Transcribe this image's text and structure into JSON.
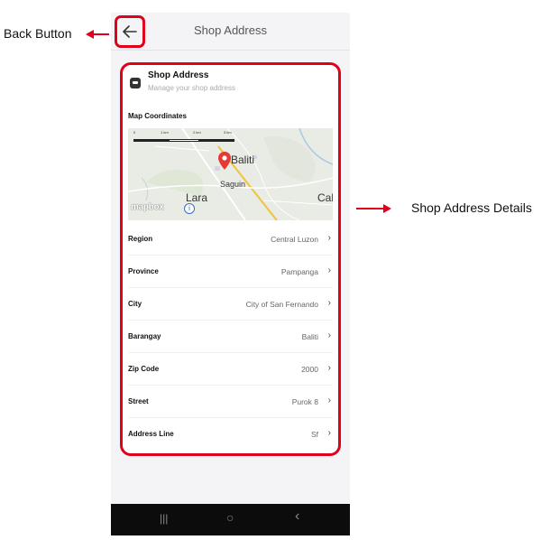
{
  "annotations": {
    "back_button": "Back Button",
    "details": "Shop Address Details"
  },
  "header": {
    "title": "Shop Address",
    "back_icon": "arrow-left-icon"
  },
  "card": {
    "title": "Shop Address",
    "subtitle": "Manage your shop address",
    "map_label": "Map Coordinates",
    "icon": "store-icon"
  },
  "map": {
    "scale_labels": [
      "0",
      "1 km",
      "2 km",
      "3 km"
    ],
    "places": [
      "Baliti",
      "Saguin",
      "Lara",
      "Cal"
    ],
    "attribution": "mapbox",
    "pin_color": "#e53935"
  },
  "rows": [
    {
      "label": "Region",
      "value": "Central Luzon"
    },
    {
      "label": "Province",
      "value": "Pampanga"
    },
    {
      "label": "City",
      "value": "City of San Fernando"
    },
    {
      "label": "Barangay",
      "value": "Baliti"
    },
    {
      "label": "Zip Code",
      "value": "2000"
    },
    {
      "label": "Street",
      "value": "Purok 8"
    },
    {
      "label": "Address Line",
      "value": "Sf"
    }
  ],
  "navbar": {
    "recents": "|||",
    "home": "○",
    "back": "‹"
  },
  "colors": {
    "highlight": "#e0001b",
    "background": "#f4f4f6"
  }
}
